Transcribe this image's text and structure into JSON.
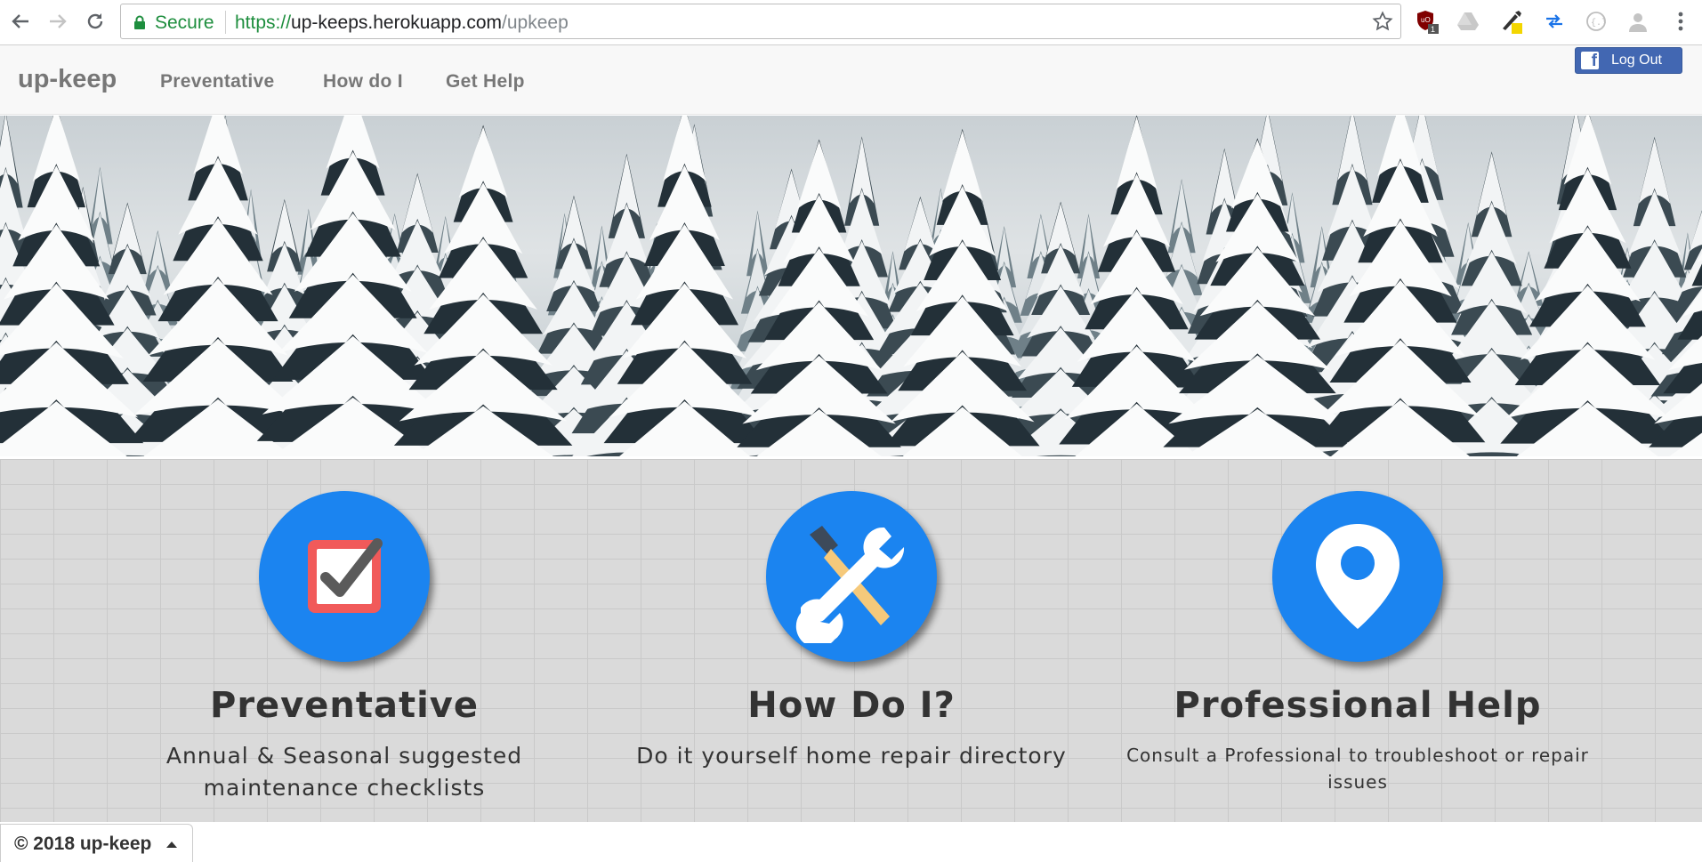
{
  "browser": {
    "secure_label": "Secure",
    "url_scheme": "https://",
    "url_host": "up-keeps.herokuapp.com",
    "url_path": "/upkeep",
    "ext_badge": "1"
  },
  "navbar": {
    "brand": "up-keep",
    "links": [
      "Preventative",
      "How do I",
      "Get Help"
    ],
    "logout_label": "Log Out"
  },
  "features": [
    {
      "title": "Preventative",
      "description": "Annual & Seasonal suggested maintenance checklists",
      "icon": "checklist-icon"
    },
    {
      "title": "How Do I?",
      "description": "Do it yourself home repair directory",
      "icon": "tools-icon"
    },
    {
      "title": "Professional Help",
      "description": "Consult a Professional to troubleshoot or repair issues",
      "icon": "location-pin-icon"
    }
  ],
  "footer": {
    "text": "© 2018 up-keep"
  },
  "colors": {
    "accent_blue": "#1b84f0",
    "facebook_blue": "#4267b2",
    "nav_text": "#777777"
  }
}
